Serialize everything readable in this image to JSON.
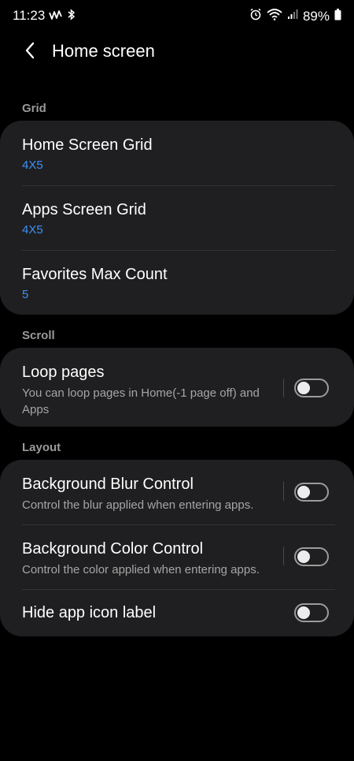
{
  "status_bar": {
    "time": "11:23",
    "battery": "89%",
    "left_icons": [
      "activity-icon",
      "bluetooth-icon"
    ],
    "right_icons": [
      "alarm-icon",
      "wifi-icon",
      "signal-icon",
      "battery-icon"
    ]
  },
  "header": {
    "title": "Home screen"
  },
  "sections": {
    "grid": {
      "label": "Grid",
      "items": [
        {
          "title": "Home Screen Grid",
          "value": "4X5"
        },
        {
          "title": "Apps Screen Grid",
          "value": "4X5"
        },
        {
          "title": "Favorites Max Count",
          "value": "5"
        }
      ]
    },
    "scroll": {
      "label": "Scroll",
      "items": [
        {
          "title": "Loop pages",
          "description": "You can loop pages in Home(-1 page off) and Apps",
          "enabled": false
        }
      ]
    },
    "layout": {
      "label": "Layout",
      "items": [
        {
          "title": "Background Blur Control",
          "description": "Control the blur applied when entering apps.",
          "enabled": false
        },
        {
          "title": "Background Color Control",
          "description": "Control the color applied when entering apps.",
          "enabled": false
        },
        {
          "title": "Hide app icon label",
          "enabled": false
        }
      ]
    }
  },
  "colors": {
    "background": "#000000",
    "card": "#1f1f21",
    "accent": "#3e91f5",
    "section_label": "#9a9a9a",
    "description": "#a5a5a5"
  }
}
